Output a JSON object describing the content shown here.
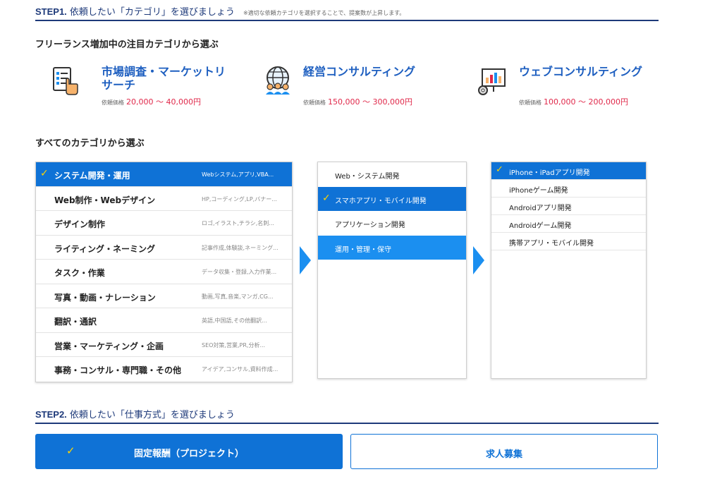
{
  "step1": {
    "num": "STEP1.",
    "title": " 依頼したい「カテゴリ」を選びましょう",
    "note": "※適切な依頼カテゴリを選択することで、提案数が上昇します。"
  },
  "featured_section": {
    "title": "フリーランス増加中の注目カテゴリから選ぶ",
    "items": [
      {
        "name": "市場調査・マーケットリサーチ",
        "price_label": "依頼価格",
        "price": "20,000 〜 40,000円",
        "icon": "checklist-hand-icon"
      },
      {
        "name": "経営コンサルティング",
        "price_label": "依頼価格",
        "price": "150,000 〜 300,000円",
        "icon": "globe-people-icon"
      },
      {
        "name": "ウェブコンサルティング",
        "price_label": "依頼価格",
        "price": "100,000 〜 200,000円",
        "icon": "chart-board-gear-icon"
      }
    ]
  },
  "all_section": {
    "title": "すべてのカテゴリから選ぶ"
  },
  "categories": [
    {
      "name": "システム開発・運用",
      "sub": "Webシステム,アプリ,VBA...",
      "selected": true
    },
    {
      "name": "Web制作・Webデザイン",
      "sub": "HP,コーディング,LP,バナー..."
    },
    {
      "name": "デザイン制作",
      "sub": "ロゴ,イラスト,チラシ,名刺..."
    },
    {
      "name": "ライティング・ネーミング",
      "sub": "記事作成,体験談,ネーミング..."
    },
    {
      "name": "タスク・作業",
      "sub": "データ収集・登録,入力作業..."
    },
    {
      "name": "写真・動画・ナレーション",
      "sub": "動画,写真,音楽,マンガ,CG..."
    },
    {
      "name": "翻訳・通訳",
      "sub": "英語,中国語,その他翻訳..."
    },
    {
      "name": "営業・マーケティング・企画",
      "sub": "SEO対策,営業,PR,分析..."
    },
    {
      "name": "事務・コンサル・専門職・その他",
      "sub": "アイデア,コンサル,資料作成..."
    }
  ],
  "subcategories": [
    {
      "name": "Web・システム開発"
    },
    {
      "name": "スマホアプリ・モバイル開発",
      "selected": true
    },
    {
      "name": "アプリケーション開発"
    },
    {
      "name": "運用・管理・保守",
      "highlight": true
    }
  ],
  "details": [
    {
      "name": "iPhone・iPadアプリ開発",
      "selected": true
    },
    {
      "name": "iPhoneゲーム開発"
    },
    {
      "name": "Androidアプリ開発"
    },
    {
      "name": "Androidゲーム開発"
    },
    {
      "name": "携帯アプリ・モバイル開発"
    }
  ],
  "check_glyph": "✓",
  "step2": {
    "num": "STEP2.",
    "title": " 依頼したい「仕事方式」を選びましょう",
    "fixed_label": "固定報酬（プロジェクト）",
    "recruit_label": "求人募集"
  },
  "colors": {
    "primary": "#0f72d6",
    "accent_blue": "#1b8ff0",
    "navy": "#1e3a7a",
    "price_red": "#e0284a",
    "check_yellow": "#ffd400"
  }
}
